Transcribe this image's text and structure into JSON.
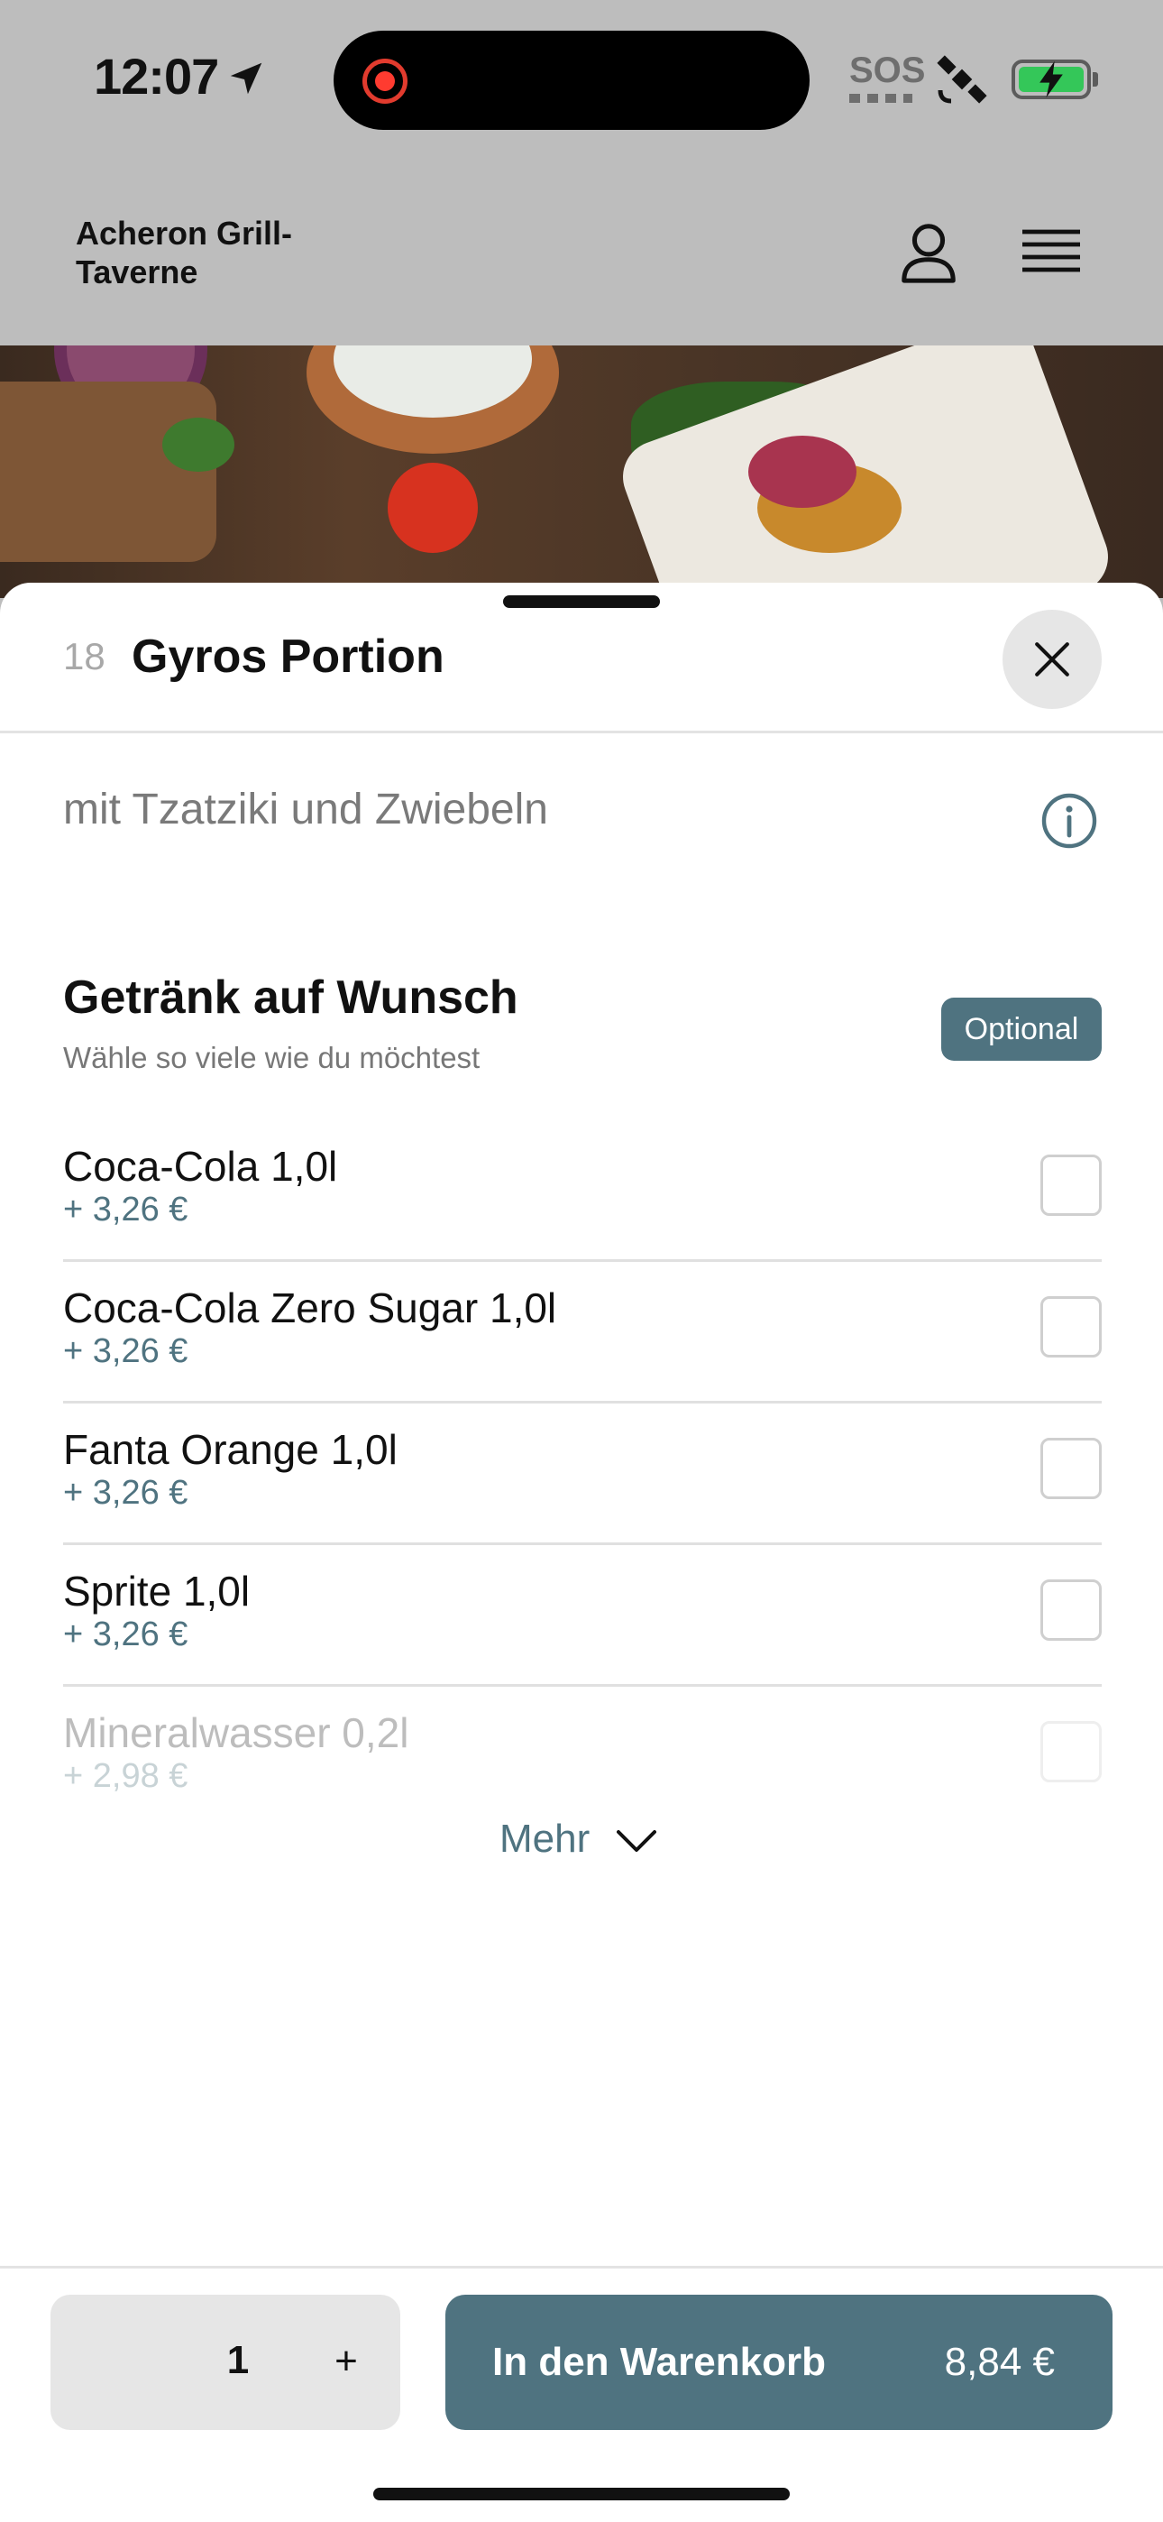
{
  "status_bar": {
    "time": "12:07",
    "sos": "SOS",
    "icons": [
      "location-arrow-icon",
      "screen-recording-icon",
      "satellite-icon",
      "battery-charging-icon"
    ]
  },
  "header": {
    "brand": "Acheron Grill-Taverne",
    "icons": [
      "user-icon",
      "hamburger-menu-icon"
    ]
  },
  "sheet": {
    "item_number": "18",
    "item_title": "Gyros Portion",
    "description": "mit Tzatziki und Zwiebeln",
    "group": {
      "title": "Getränk auf Wunsch",
      "subtitle": "Wähle so viele wie du möchtest",
      "badge": "Optional",
      "options": [
        {
          "name": "Coca-Cola 1,0l",
          "price": "+ 3,26 €",
          "checked": false
        },
        {
          "name": "Coca-Cola Zero Sugar 1,0l",
          "price": "+ 3,26 €",
          "checked": false
        },
        {
          "name": "Fanta Orange 1,0l",
          "price": "+ 3,26 €",
          "checked": false
        },
        {
          "name": "Sprite 1,0l",
          "price": "+ 3,26 €",
          "checked": false
        },
        {
          "name": "Mineralwasser 0,2l",
          "price": "+ 2,98 €",
          "checked": false
        }
      ],
      "more_label": "Mehr"
    }
  },
  "footer": {
    "quantity": "1",
    "plus": "+",
    "cart_label": "In den Warenkorb",
    "cart_price": "8,84 €"
  },
  "colors": {
    "accent": "#4f7380",
    "overlay": "#bdbdbd",
    "record": "#ff3b30",
    "battery": "#34c759"
  }
}
